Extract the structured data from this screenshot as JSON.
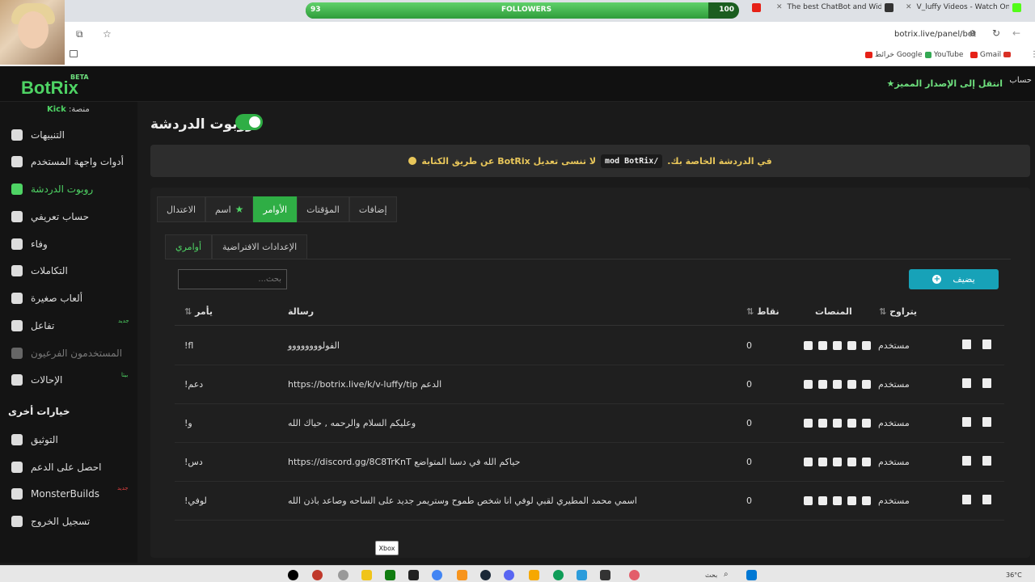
{
  "browser": {
    "followers": {
      "label": "FOLLOWERS",
      "current": "93",
      "goal": "100",
      "progress": 0.93
    },
    "tabs": [
      {
        "title": "The best ChatBot and Widgets"
      },
      {
        "title": "V_luffy Videos - Watch On-Dem"
      }
    ],
    "url": "botrix.live/panel/bot",
    "bookmarks": [
      "Gmail",
      "YouTube",
      "خرائط Google"
    ]
  },
  "header": {
    "logo": "BotRix",
    "beta": "BETA",
    "upgrade": "انتقل إلى الإصدار المميز",
    "account": "حساب"
  },
  "sidebar": {
    "platform_prefix": "منصة:",
    "platform": "Kick",
    "items": [
      {
        "label": "التنبيهات",
        "icon": "warning-icon"
      },
      {
        "label": "أدوات واجهة المستخدم",
        "icon": "grid-icon"
      },
      {
        "label": "روبوت الدردشة",
        "icon": "robot-icon"
      },
      {
        "label": "حساب تعريفي",
        "icon": "id-card-icon"
      },
      {
        "label": "وفاء",
        "icon": "trophy-icon"
      },
      {
        "label": "التكاملات",
        "icon": "integrations-icon"
      },
      {
        "label": "ألعاب صغيرة",
        "icon": "gamepad-icon"
      },
      {
        "label": "تفاعل",
        "icon": "music-icon",
        "badge": "جديد"
      },
      {
        "label": "المستخدمون الفرعيون",
        "icon": "users-icon"
      },
      {
        "label": "الإحالات",
        "icon": "referrals-icon",
        "badge": "بيتا"
      }
    ],
    "other_title": "خيارات أخرى",
    "other_items": [
      {
        "label": "التوثيق",
        "icon": "docs-icon"
      },
      {
        "label": "احصل على الدعم",
        "icon": "help-icon"
      },
      {
        "label": "MonsterBuilds",
        "icon": "laptop-icon",
        "badge": "جديد"
      },
      {
        "label": "تسجيل الخروج",
        "icon": "logout-icon"
      }
    ]
  },
  "main": {
    "title": "روبوت الدردشة",
    "alert": {
      "before": "في الدردشة الخاصة بك.",
      "code": "/mod BotRix",
      "after": "لا تنسى تعديل BotRix عن طريق الكتابة"
    },
    "tabs": [
      "إضافات",
      "المؤقتات",
      "الأوامر",
      "اسم",
      "الاعتدال"
    ],
    "subtabs": [
      "الإعدادات الافتراضية",
      "أوامري"
    ],
    "search_placeholder": "بحث...",
    "add_label": "يضيف",
    "columns": {
      "level": "يتراوح",
      "platforms": "المنصات",
      "points": "نقاط",
      "message": "رسالة",
      "command": "يأمر"
    },
    "rows": [
      {
        "level": "مستخدم",
        "points": "0",
        "message": "الفولوووووووو",
        "command": "!fl"
      },
      {
        "level": "مستخدم",
        "points": "0",
        "message": "https://botrix.live/k/v-luffy/tip الدعم",
        "command": "!دعم"
      },
      {
        "level": "مستخدم",
        "points": "0",
        "message": "وعليكم السلام والرحمه , حياك الله",
        "command": "!و"
      },
      {
        "level": "مستخدم",
        "points": "0",
        "message": "https://discord.gg/8C8TrKnT حياكم الله في دسنا المتواضع",
        "command": "!دس"
      },
      {
        "level": "مستخدم",
        "points": "0",
        "message": "اسمي محمد المطيري لقبي لوفي انا شخص طموح وستريمر جديد على الساحه وصاعد باذن الله",
        "command": "!لوفي"
      }
    ],
    "platform_icons": [
      "kick-icon",
      "discord-icon",
      "youtube-icon",
      "twitch-icon",
      "trovo-icon"
    ]
  },
  "taskbar": {
    "tooltip": "Xbox",
    "search": "بحث",
    "temperature": "36°C"
  }
}
